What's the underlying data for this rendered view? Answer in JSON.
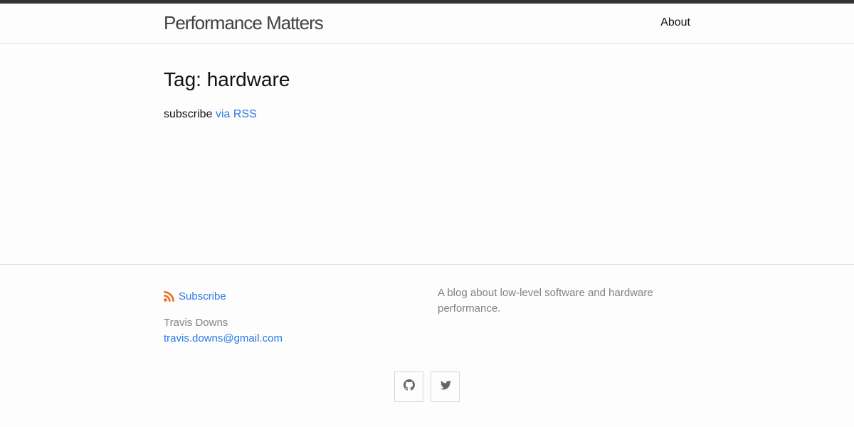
{
  "header": {
    "site_title": "Performance Matters",
    "nav": [
      {
        "label": "About"
      }
    ]
  },
  "main": {
    "heading": "Tag: hardware",
    "subscribe_text": "subscribe",
    "subscribe_link": "via RSS"
  },
  "footer": {
    "rss_label": "Subscribe",
    "author_name": "Travis Downs",
    "author_email": "travis.downs@gmail.com",
    "description": "A blog about low-level software and hardware performance.",
    "social": [
      {
        "icon": "github-icon"
      },
      {
        "icon": "twitter-icon"
      }
    ]
  },
  "colors": {
    "link": "#2a7ae2",
    "rss": "#e8701a",
    "muted_text": "#828282",
    "top_bar": "#333333",
    "title": "#424242"
  }
}
